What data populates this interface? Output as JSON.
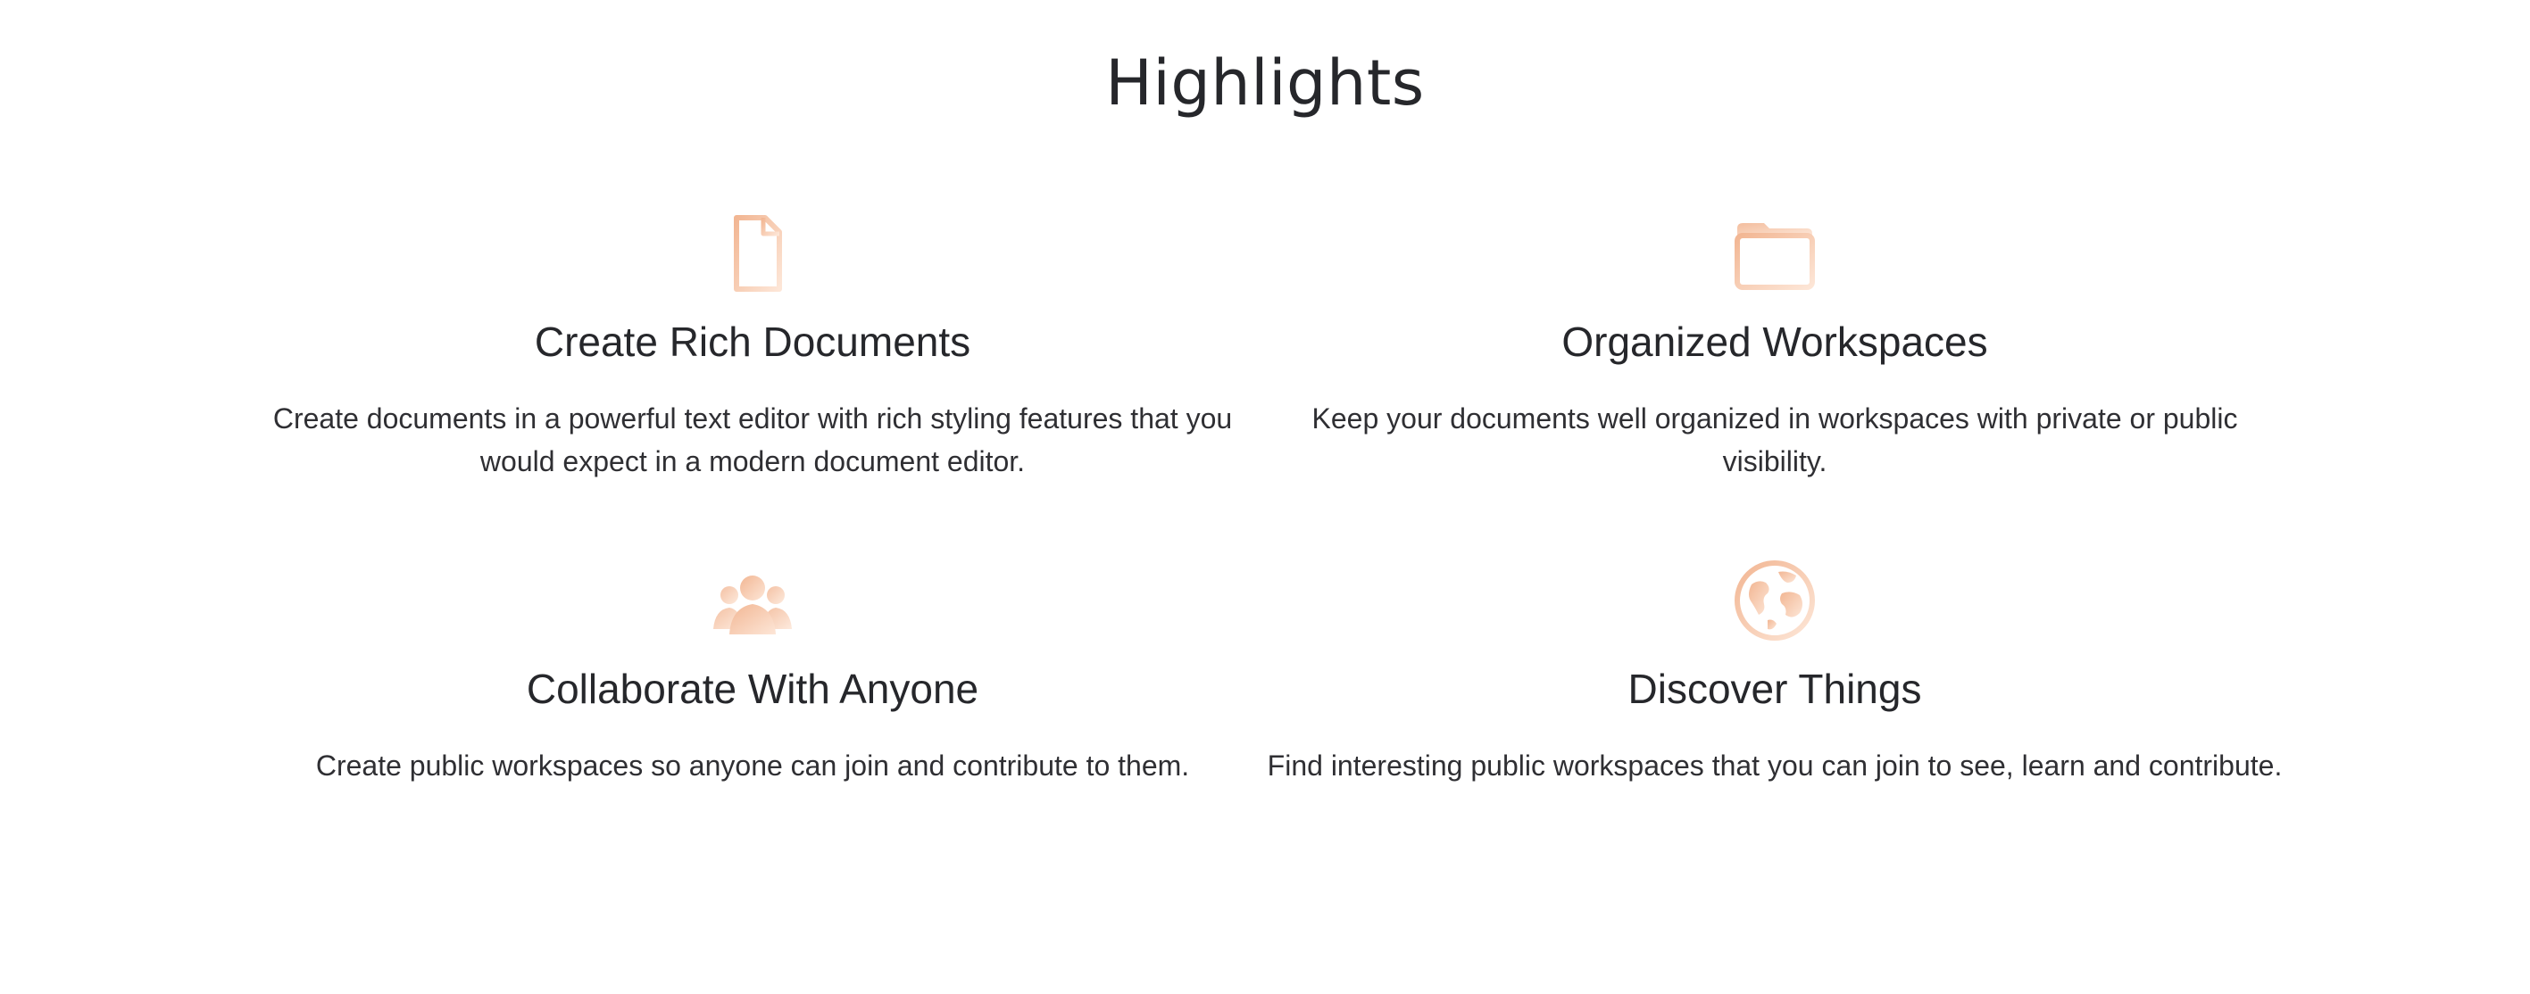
{
  "section": {
    "title": "Highlights"
  },
  "colors": {
    "icon_gradient_start": "#f2b896",
    "icon_gradient_end": "#fce4d4",
    "text": "#26272b"
  },
  "features": [
    {
      "icon": "document-icon",
      "title": "Create Rich Documents",
      "description": "Create documents in a powerful text editor with rich styling features that you would expect in a modern document editor."
    },
    {
      "icon": "folder-icon",
      "title": "Organized Workspaces",
      "description": "Keep your documents well organized in workspaces with private or public visibility."
    },
    {
      "icon": "users-icon",
      "title": "Collaborate With Anyone",
      "description": "Create public workspaces so anyone can join and contribute to them."
    },
    {
      "icon": "globe-icon",
      "title": "Discover Things",
      "description": "Find interesting public workspaces that you can join to see, learn and contribute."
    }
  ]
}
